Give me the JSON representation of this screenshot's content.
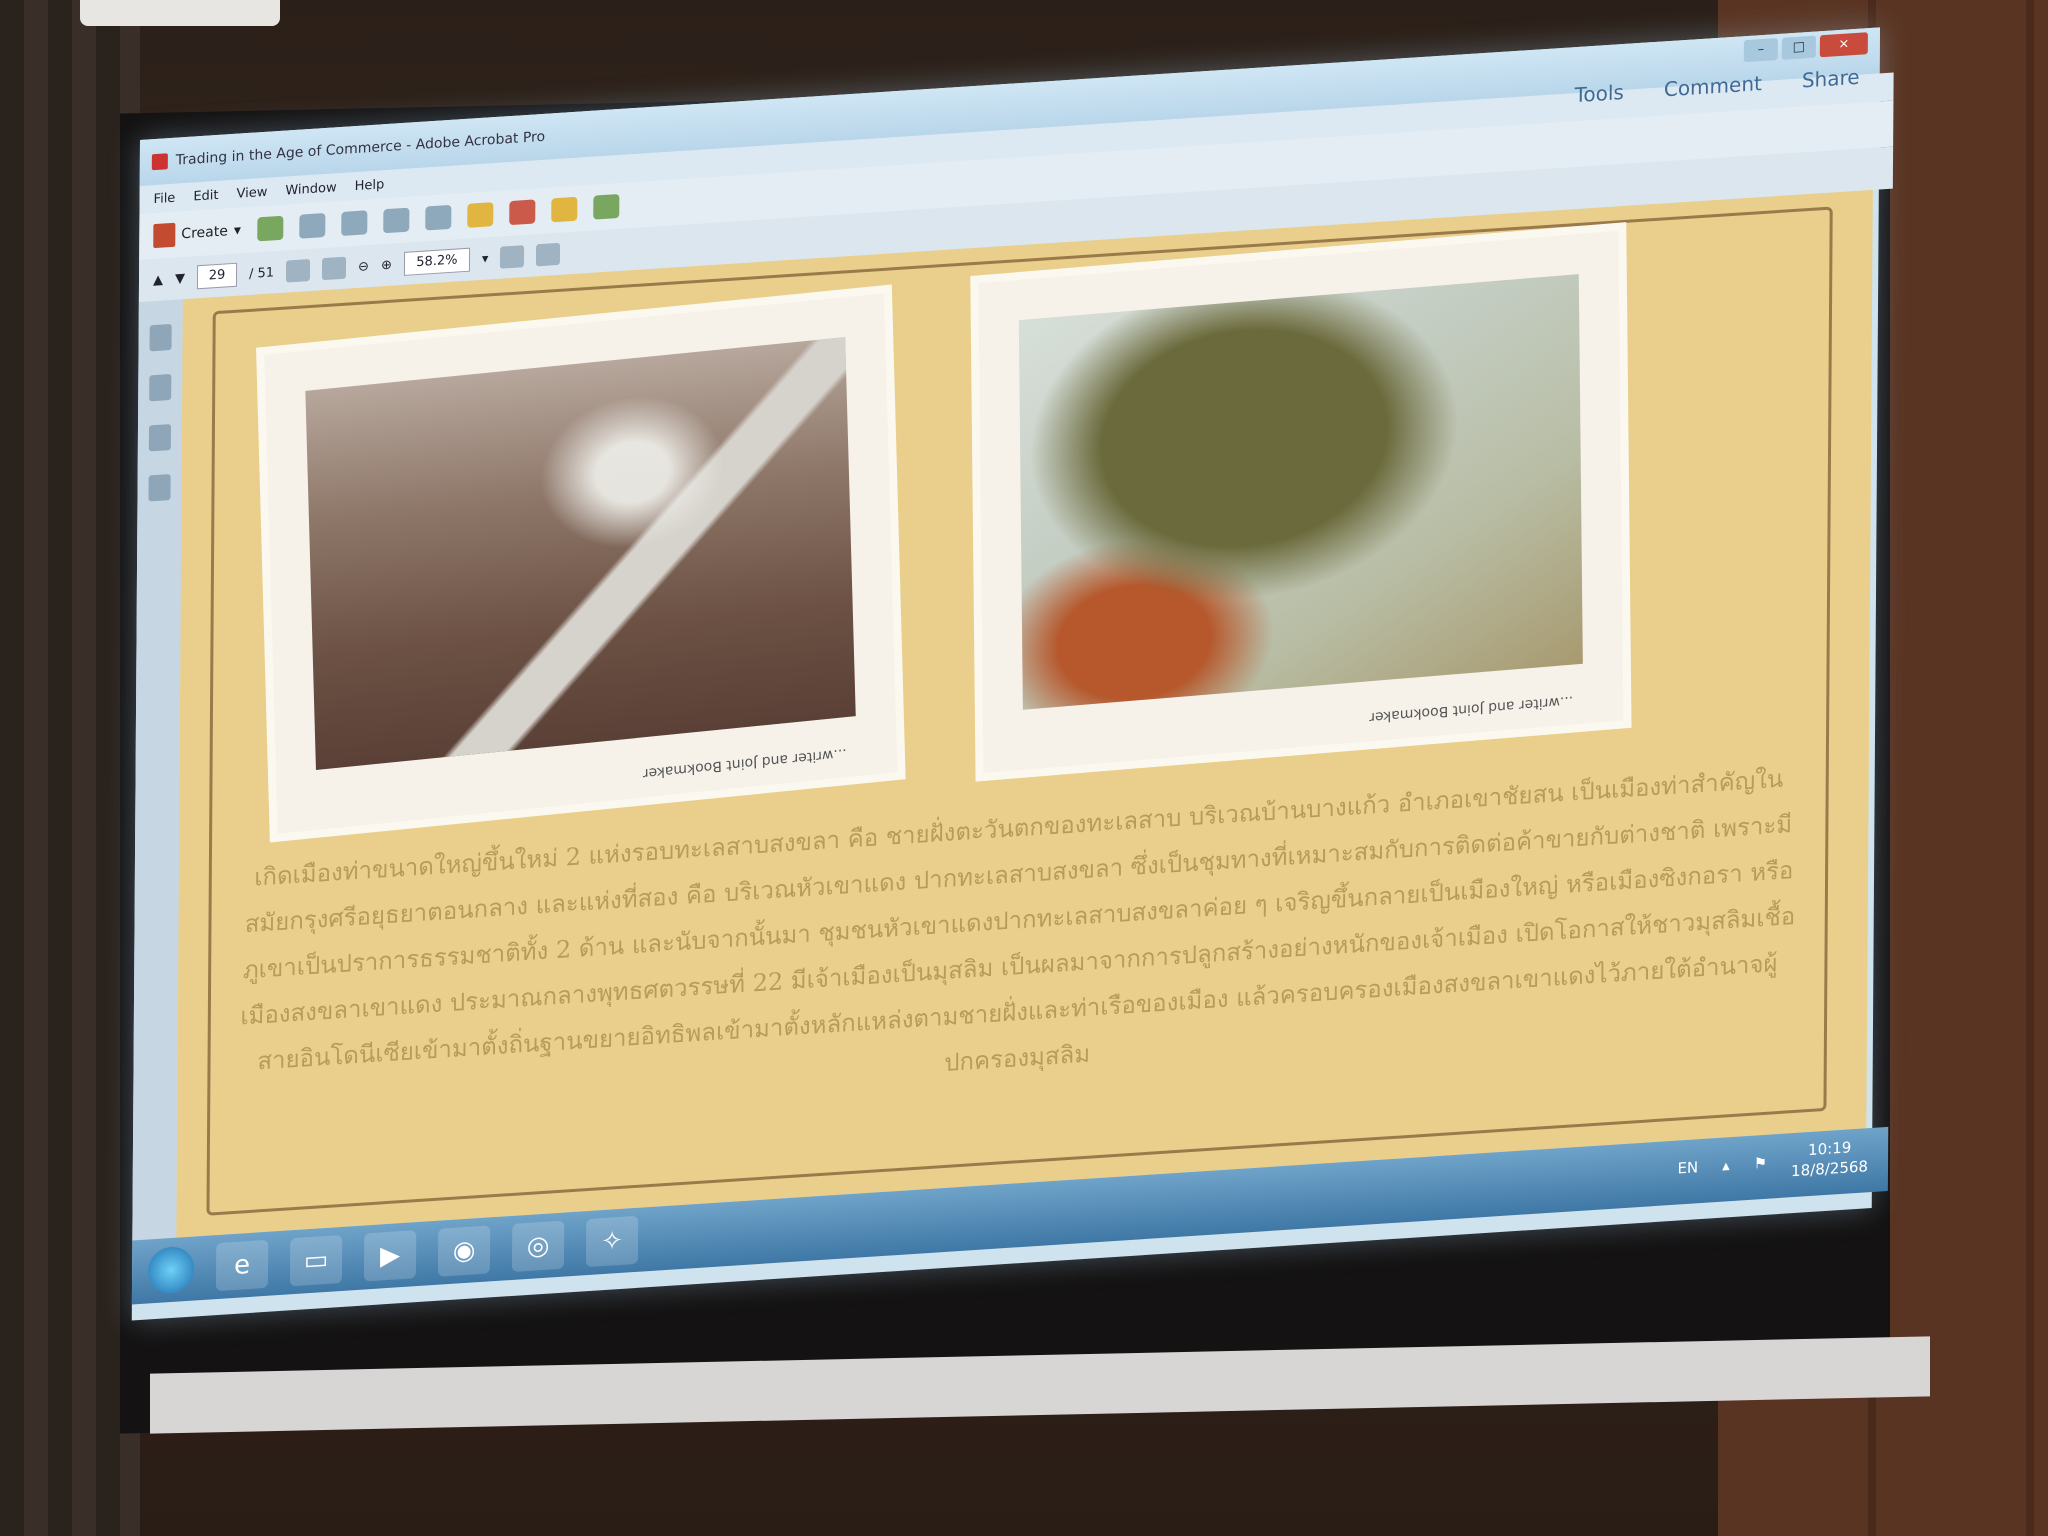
{
  "window": {
    "title": "Trading in the Age of Commerce - Adobe Acrobat Pro",
    "controls": {
      "minimize": "–",
      "maximize": "□",
      "close": "×"
    }
  },
  "menu": [
    "File",
    "Edit",
    "View",
    "Window",
    "Help"
  ],
  "right_buttons": {
    "tools": "Tools",
    "comment": "Comment",
    "share": "Share"
  },
  "toolbar": {
    "create_label": "Create",
    "page_current": "29",
    "page_total": "/ 51",
    "zoom": "58.2%"
  },
  "document": {
    "photo1_caption": "...writer and Joint Bookmaker",
    "photo2_caption": "...writer and Joint Bookmaker",
    "thai_paragraph": "เกิดเมืองท่าขนาดใหญ่ขึ้นใหม่ 2 แห่งรอบทะเลสาบสงขลา คือ ชายฝั่งตะวันตกของทะเลสาบ บริเวณบ้านบางแก้ว อำเภอเขาชัยสน เป็นเมืองท่าสำคัญในสมัยกรุงศรีอยุธยาตอนกลาง และแห่งที่สอง คือ บริเวณหัวเขาแดง ปากทะเลสาบสงขลา ซึ่งเป็นชุมทางที่เหมาะสมกับการติดต่อค้าขายกับต่างชาติ เพราะมีภูเขาเป็นปราการธรรมชาติทั้ง 2 ด้าน และนับจากนั้นมา ชุมชนหัวเขาแดงปากทะเลสาบสงขลาค่อย ๆ เจริญขึ้นกลายเป็นเมืองใหญ่ หรือเมืองซิงกอรา หรือเมืองสงขลาเขาแดง ประมาณกลางพุทธศตวรรษที่ 22 มีเจ้าเมืองเป็นมุสลิม เป็นผลมาจากการปลูกสร้างอย่างหนักของเจ้าเมือง เปิดโอกาสให้ชาวมุสลิมเชื้อสายอินโดนีเซียเข้ามาตั้งถิ่นฐานขยายอิทธิพลเข้ามาตั้งหลักแหล่งตามชายฝั่งและท่าเรือของเมือง แล้วครอบครองเมืองสงขลาเขาแดงไว้ภายใต้อำนาจผู้ปกครองมุสลิม"
  },
  "taskbar": {
    "language": "EN",
    "time": "10:19",
    "date": "18/8/2568"
  },
  "colors": {
    "page_bg": "#e9cf8b",
    "taskbar": "#3f78a6",
    "accent": "#3f6a95"
  }
}
